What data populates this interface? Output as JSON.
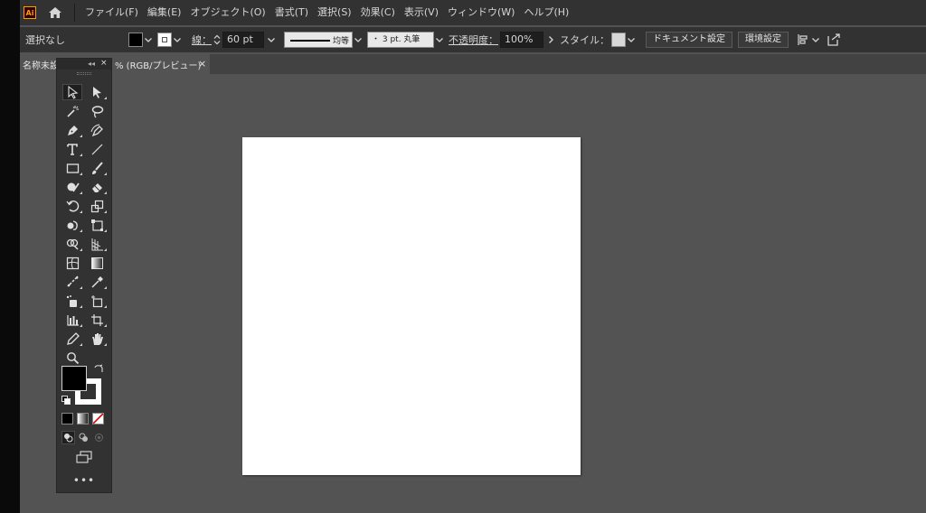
{
  "app": {
    "logo_text": "Ai",
    "colors": {
      "logo_border": "#ff9a00",
      "logo_bg": "#330000",
      "panel_bg": "#323232",
      "canvas_bg": "#535353",
      "artboard": "#ffffff"
    }
  },
  "menu": {
    "items": [
      {
        "label": "ファイル(F)"
      },
      {
        "label": "編集(E)"
      },
      {
        "label": "オブジェクト(O)"
      },
      {
        "label": "書式(T)"
      },
      {
        "label": "選択(S)"
      },
      {
        "label": "効果(C)"
      },
      {
        "label": "表示(V)"
      },
      {
        "label": "ウィンドウ(W)"
      },
      {
        "label": "ヘルプ(H)"
      }
    ]
  },
  "control": {
    "selection_status": "選択なし",
    "fill_color": "#000000",
    "stroke_label": "線：",
    "stroke_weight": "60 pt",
    "stroke_profile": "均等",
    "brush_label": "・ 3 pt. 丸筆",
    "opacity_label": "不透明度：",
    "opacity_value": "100%",
    "style_label": "スタイル：",
    "document_setup": "ドキュメント設定",
    "preferences": "環境設定"
  },
  "tabs": {
    "toolbar_title": "名称未設",
    "document": "% (RGB/プレビュー)",
    "close": "×"
  },
  "tools": [
    {
      "name": "selection-tool",
      "icon": "selection-arrow-icon"
    },
    {
      "name": "direct-selection-tool",
      "icon": "direct-selection-icon"
    },
    {
      "name": "magic-wand-tool",
      "icon": "magic-wand-icon"
    },
    {
      "name": "lasso-tool",
      "icon": "lasso-icon"
    },
    {
      "name": "pen-tool",
      "icon": "pen-icon"
    },
    {
      "name": "curvature-tool",
      "icon": "curvature-icon"
    },
    {
      "name": "type-tool",
      "icon": "type-icon"
    },
    {
      "name": "line-tool",
      "icon": "line-icon"
    },
    {
      "name": "rectangle-tool",
      "icon": "rectangle-icon"
    },
    {
      "name": "paintbrush-tool",
      "icon": "paintbrush-icon"
    },
    {
      "name": "shaper-tool",
      "icon": "shaper-icon"
    },
    {
      "name": "eraser-tool",
      "icon": "eraser-icon"
    },
    {
      "name": "rotate-tool",
      "icon": "rotate-icon"
    },
    {
      "name": "scale-tool",
      "icon": "scale-icon"
    },
    {
      "name": "warp-tool",
      "icon": "warp-icon"
    },
    {
      "name": "free-transform-tool",
      "icon": "free-transform-icon"
    },
    {
      "name": "shape-builder-tool",
      "icon": "shape-builder-icon"
    },
    {
      "name": "perspective-grid-tool",
      "icon": "perspective-grid-icon"
    },
    {
      "name": "mesh-tool",
      "icon": "mesh-icon"
    },
    {
      "name": "gradient-tool",
      "icon": "gradient-icon"
    },
    {
      "name": "blend-tool",
      "icon": "blend-icon"
    },
    {
      "name": "eyedropper-tool",
      "icon": "eyedropper-icon"
    },
    {
      "name": "symbol-sprayer-tool",
      "icon": "symbol-sprayer-icon"
    },
    {
      "name": "artboard-tool",
      "icon": "artboard-icon"
    },
    {
      "name": "column-graph-tool",
      "icon": "column-graph-icon"
    },
    {
      "name": "slice-tool",
      "icon": "slice-icon"
    },
    {
      "name": "pencil-tool",
      "icon": "pencil-icon"
    },
    {
      "name": "hand-tool",
      "icon": "hand-icon"
    },
    {
      "name": "zoom-tool",
      "icon": "zoom-icon"
    }
  ],
  "panel": {
    "more": "•••"
  }
}
